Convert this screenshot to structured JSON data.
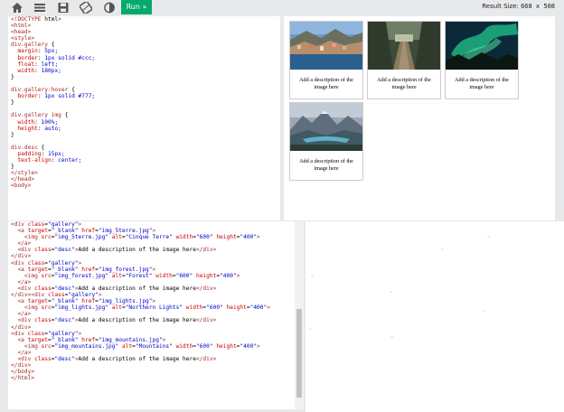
{
  "toolbar": {
    "icons": [
      "home-icon",
      "menu-icon",
      "save-icon",
      "rotate-icon",
      "contrast-icon"
    ],
    "run_label": "Run »",
    "result_size_label": "Result Size:",
    "result_size_value": "668 x 508"
  },
  "colors": {
    "run_green": "#04aa6d",
    "tag": "#a52a2a",
    "property": "#cc0000",
    "value": "#0000cd"
  },
  "code_top": [
    "<!DOCTYPE html>",
    "<html>",
    "<head>",
    "<style>",
    "div.gallery {",
    "  margin: 5px;",
    "  border: 1px solid #ccc;",
    "  float: left;",
    "  width: 180px;",
    "}",
    "",
    "div.gallery:hover {",
    "  border: 1px solid #777;",
    "}",
    "",
    "div.gallery img {",
    "  width: 100%;",
    "  height: auto;",
    "}",
    "",
    "div.desc {",
    "  padding: 15px;",
    "  text-align: center;",
    "}",
    "</style>",
    "</head>",
    "<body>"
  ],
  "code_bottom": [
    "<div class=\"gallery\">",
    "  <a target=\"_blank\" href=\"img_5terre.jpg\">",
    "    <img src=\"img_5terre.jpg\" alt=\"Cinque Terre\" width=\"600\" height=\"400\">",
    "  </a>",
    "  <div class=\"desc\">Add a description of the image here</div>",
    "</div>",
    "<div class=\"gallery\">",
    "  <a target=\"_blank\" href=\"img_forest.jpg\">",
    "    <img src=\"img_forest.jpg\" alt=\"Forest\" width=\"600\" height=\"400\">",
    "  </a>",
    "  <div class=\"desc\">Add a description of the image here</div>",
    "</div><div class=\"gallery\">",
    "  <a target=\"_blank\" href=\"img_lights.jpg\">",
    "    <img src=\"img_lights.jpg\" alt=\"Northern Lights\" width=\"600\" height=\"400\">",
    "  </a>",
    "  <div class=\"desc\">Add a description of the image here</div>",
    "</div>",
    "<div class=\"gallery\">",
    "  <a target=\"_blank\" href=\"img_mountains.jpg\">",
    "    <img src=\"img_mountains.jpg\" alt=\"Mountains\" width=\"600\" height=\"400\">",
    "  </a>",
    "  <div class=\"desc\">Add a description of the image here</div>",
    "</div>",
    "</body>",
    "</html>"
  ],
  "gallery": [
    {
      "image": "Cinque Terre",
      "description": "Add a description of the image here"
    },
    {
      "image": "Forest",
      "description": "Add a description of the image here"
    },
    {
      "image": "Northern Lights",
      "description": "Add a description of the image here"
    },
    {
      "image": "Mountains",
      "description": "Add a description of the image here"
    }
  ]
}
